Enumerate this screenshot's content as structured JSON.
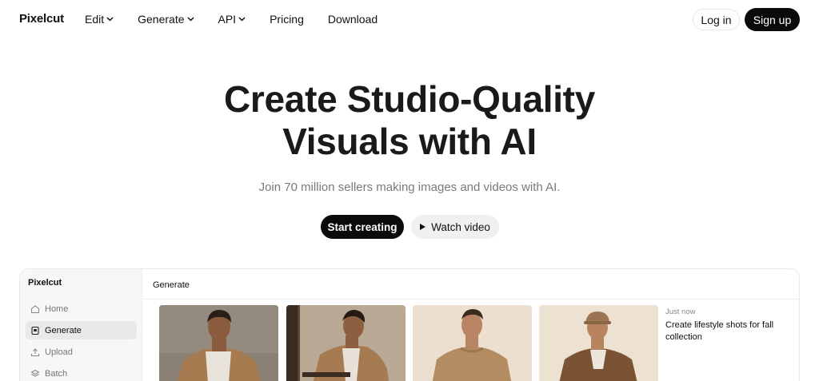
{
  "brand": "Pixelcut",
  "nav": {
    "items": [
      {
        "label": "Edit",
        "has_dropdown": true
      },
      {
        "label": "Generate",
        "has_dropdown": true
      },
      {
        "label": "API",
        "has_dropdown": true
      },
      {
        "label": "Pricing",
        "has_dropdown": false
      },
      {
        "label": "Download",
        "has_dropdown": false
      }
    ],
    "login_label": "Log in",
    "signup_label": "Sign up"
  },
  "hero": {
    "title_line1": "Create Studio-Quality",
    "title_line2": "Visuals with AI",
    "subtitle": "Join 70 million sellers making images and videos with AI.",
    "primary_cta": "Start creating",
    "secondary_cta": "Watch video",
    "secondary_icon": "play-icon"
  },
  "app_preview": {
    "sidebar": {
      "brand": "Pixelcut",
      "items": [
        {
          "label": "Home",
          "icon": "home-icon",
          "active": false
        },
        {
          "label": "Generate",
          "icon": "generate-icon",
          "active": true
        },
        {
          "label": "Upload",
          "icon": "upload-icon",
          "active": false
        },
        {
          "label": "Batch",
          "icon": "layers-icon",
          "active": false
        }
      ]
    },
    "header_title": "Generate",
    "images": [
      {
        "alt": "man in tan coat and white turtleneck"
      },
      {
        "alt": "man seated in tan coat"
      },
      {
        "alt": "man in tan knit sweater"
      },
      {
        "alt": "man in cap and brown jacket"
      }
    ],
    "activity": {
      "time": "Just now",
      "prompt": "Create lifestyle shots for fall collection"
    }
  },
  "colors": {
    "primary_button": "#0b0b0b",
    "secondary_button": "#f0f0f0",
    "subtitle_text": "#7a7a7a",
    "sidebar_bg": "#f7f7f7",
    "sidebar_active": "#e9e9e9"
  }
}
